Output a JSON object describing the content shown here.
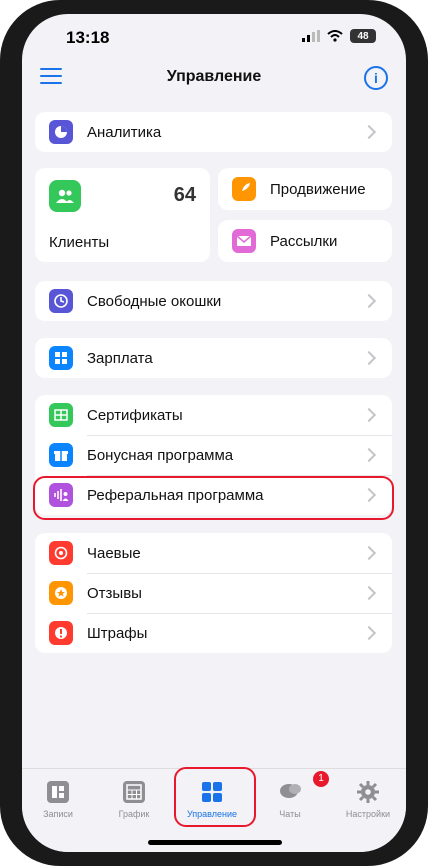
{
  "status": {
    "time": "13:18",
    "battery": "48"
  },
  "header": {
    "title": "Управление",
    "info_label": "i"
  },
  "analytics": {
    "label": "Аналитика"
  },
  "clients": {
    "label": "Клиенты",
    "count": "64"
  },
  "promotion": {
    "label": "Продвижение"
  },
  "mailings": {
    "label": "Рассылки"
  },
  "free_slots": {
    "label": "Свободные окошки"
  },
  "salary": {
    "label": "Зарплата"
  },
  "group1": [
    {
      "label": "Сертификаты"
    },
    {
      "label": "Бонусная программа"
    },
    {
      "label": "Реферальная программа"
    }
  ],
  "group2": [
    {
      "label": "Чаевые"
    },
    {
      "label": "Отзывы"
    },
    {
      "label": "Штрафы"
    }
  ],
  "tabbar": {
    "items": [
      {
        "label": "Записи"
      },
      {
        "label": "График"
      },
      {
        "label": "Управление"
      },
      {
        "label": "Чаты",
        "badge": "1"
      },
      {
        "label": "Настройки"
      }
    ]
  },
  "colors": {
    "accent": "#1a73e8",
    "highlight": "#e8192c"
  }
}
